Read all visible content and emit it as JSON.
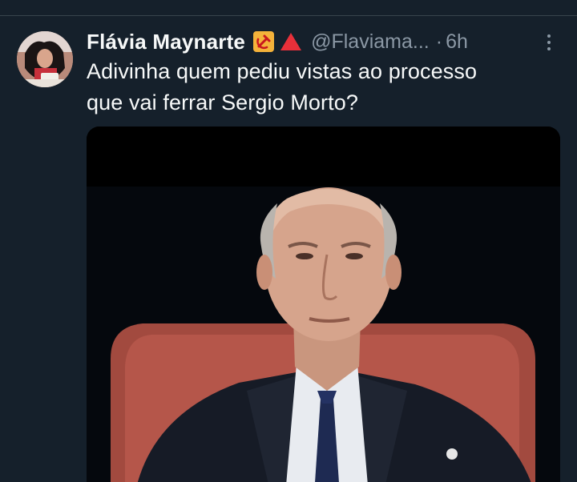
{
  "tweet": {
    "author": {
      "display_name": "Flávia Maynarte",
      "emoji_1": "hammer-and-sickle-emoji",
      "emoji_2": "red-triangle-emoji",
      "handle": "@Flaviama...",
      "separator": "·",
      "time": "6h"
    },
    "text_lines": [
      "Adivinha quem pediu vistas ao processo",
      "que vai ferrar Sergio Morto?"
    ],
    "media": {
      "icon": "photo-of-man-in-judicial-robe"
    }
  },
  "colors": {
    "background": "#15202b",
    "primary_text": "#f7f9f9",
    "secondary_text": "#8b98a5",
    "divider": "#38444d"
  }
}
